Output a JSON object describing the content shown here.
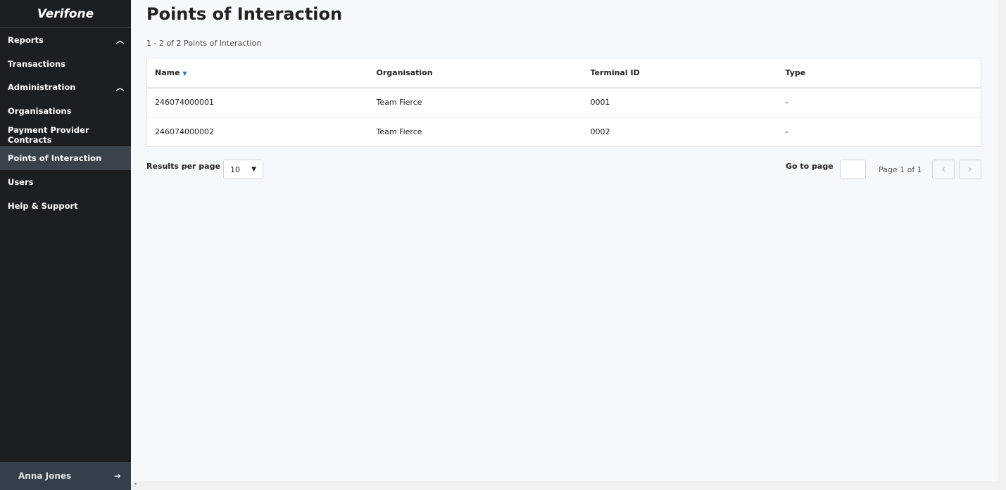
{
  "brand": "Verifone",
  "sidebar": {
    "items": [
      {
        "label": "Reports",
        "chevron": true
      },
      {
        "label": "Transactions"
      },
      {
        "label": "Administration",
        "chevron": true
      },
      {
        "label": "Organisations"
      },
      {
        "label": "Payment Provider Contracts"
      },
      {
        "label": "Points of Interaction",
        "active": true
      },
      {
        "label": "Users"
      },
      {
        "label": "Help & Support"
      }
    ],
    "user": "Anna Jones"
  },
  "page": {
    "title": "Points of Interaction",
    "count": "1 - 2 of 2 Points of Interaction"
  },
  "table": {
    "headers": [
      "Name",
      "Organisation",
      "Terminal ID",
      "Type"
    ],
    "rows": [
      [
        "246074000001",
        "Team Fierce",
        "0001",
        "-"
      ],
      [
        "246074000002",
        "Team Fierce",
        "0002",
        "-"
      ]
    ]
  },
  "pagination": {
    "results_label": "Results per page",
    "per_page": "10",
    "goto_label": "Go to page",
    "goto_value": "",
    "page_info": "Page 1 of 1"
  }
}
